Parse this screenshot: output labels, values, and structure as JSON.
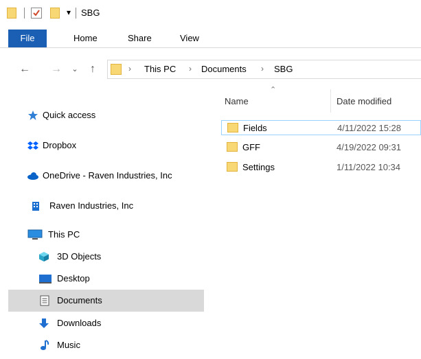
{
  "window": {
    "title": "SBG"
  },
  "ribbon": {
    "tabs": [
      "File",
      "Home",
      "Share",
      "View"
    ]
  },
  "address": {
    "crumbs": [
      "This PC",
      "Documents",
      "SBG"
    ]
  },
  "columns": {
    "name": "Name",
    "date": "Date modified"
  },
  "files": [
    {
      "name": "Fields",
      "date": "4/11/2022 15:28"
    },
    {
      "name": "GFF",
      "date": "4/19/2022 09:31"
    },
    {
      "name": "Settings",
      "date": "1/11/2022 10:34"
    }
  ],
  "sidebar": {
    "quick_access": "Quick access",
    "dropbox": "Dropbox",
    "onedrive": "OneDrive - Raven Industries, Inc",
    "raven": "Raven Industries, Inc",
    "this_pc": "This PC",
    "objects3d": "3D Objects",
    "desktop": "Desktop",
    "documents": "Documents",
    "downloads": "Downloads",
    "music": "Music"
  },
  "colors": {
    "accent": "#1a5fb4",
    "folder": "#f8d775",
    "selected": "#d9d9d9"
  }
}
